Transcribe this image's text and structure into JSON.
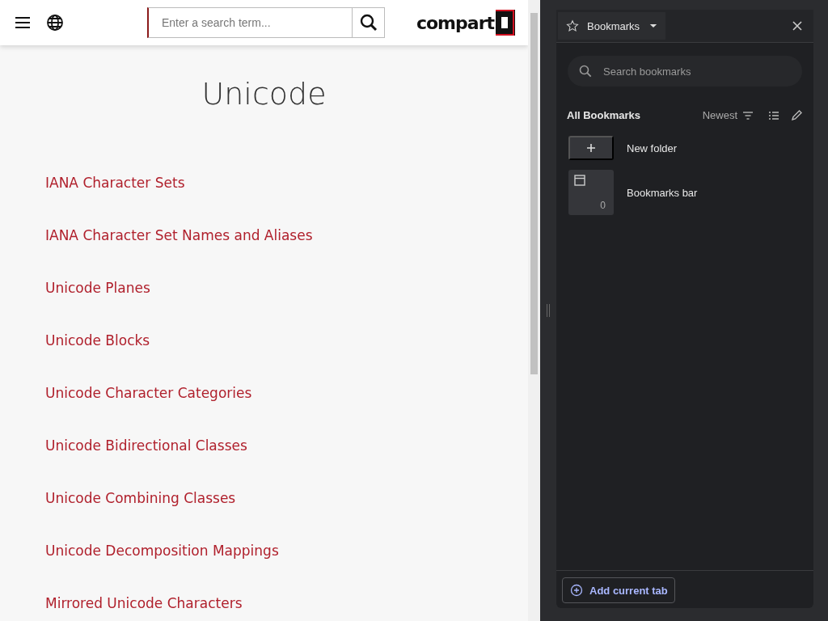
{
  "site": {
    "search": {
      "placeholder": "Enter a search term..."
    },
    "logo": "compart",
    "heading": "Unicode",
    "links": [
      "IANA Character Sets",
      "IANA Character Set Names and Aliases",
      "Unicode Planes",
      "Unicode Blocks",
      "Unicode Character Categories",
      "Unicode Bidirectional Classes",
      "Unicode Combining Classes",
      "Unicode Decomposition Mappings",
      "Mirrored Unicode Characters"
    ]
  },
  "bookmarks_panel": {
    "title": "Bookmarks",
    "search": {
      "placeholder": "Search bookmarks"
    },
    "section_title": "All Bookmarks",
    "sort": "Newest",
    "items": [
      {
        "kind": "action",
        "label": "New folder"
      },
      {
        "kind": "folder",
        "label": "Bookmarks bar",
        "count": "0"
      }
    ],
    "footer_button": "Add current tab"
  }
}
